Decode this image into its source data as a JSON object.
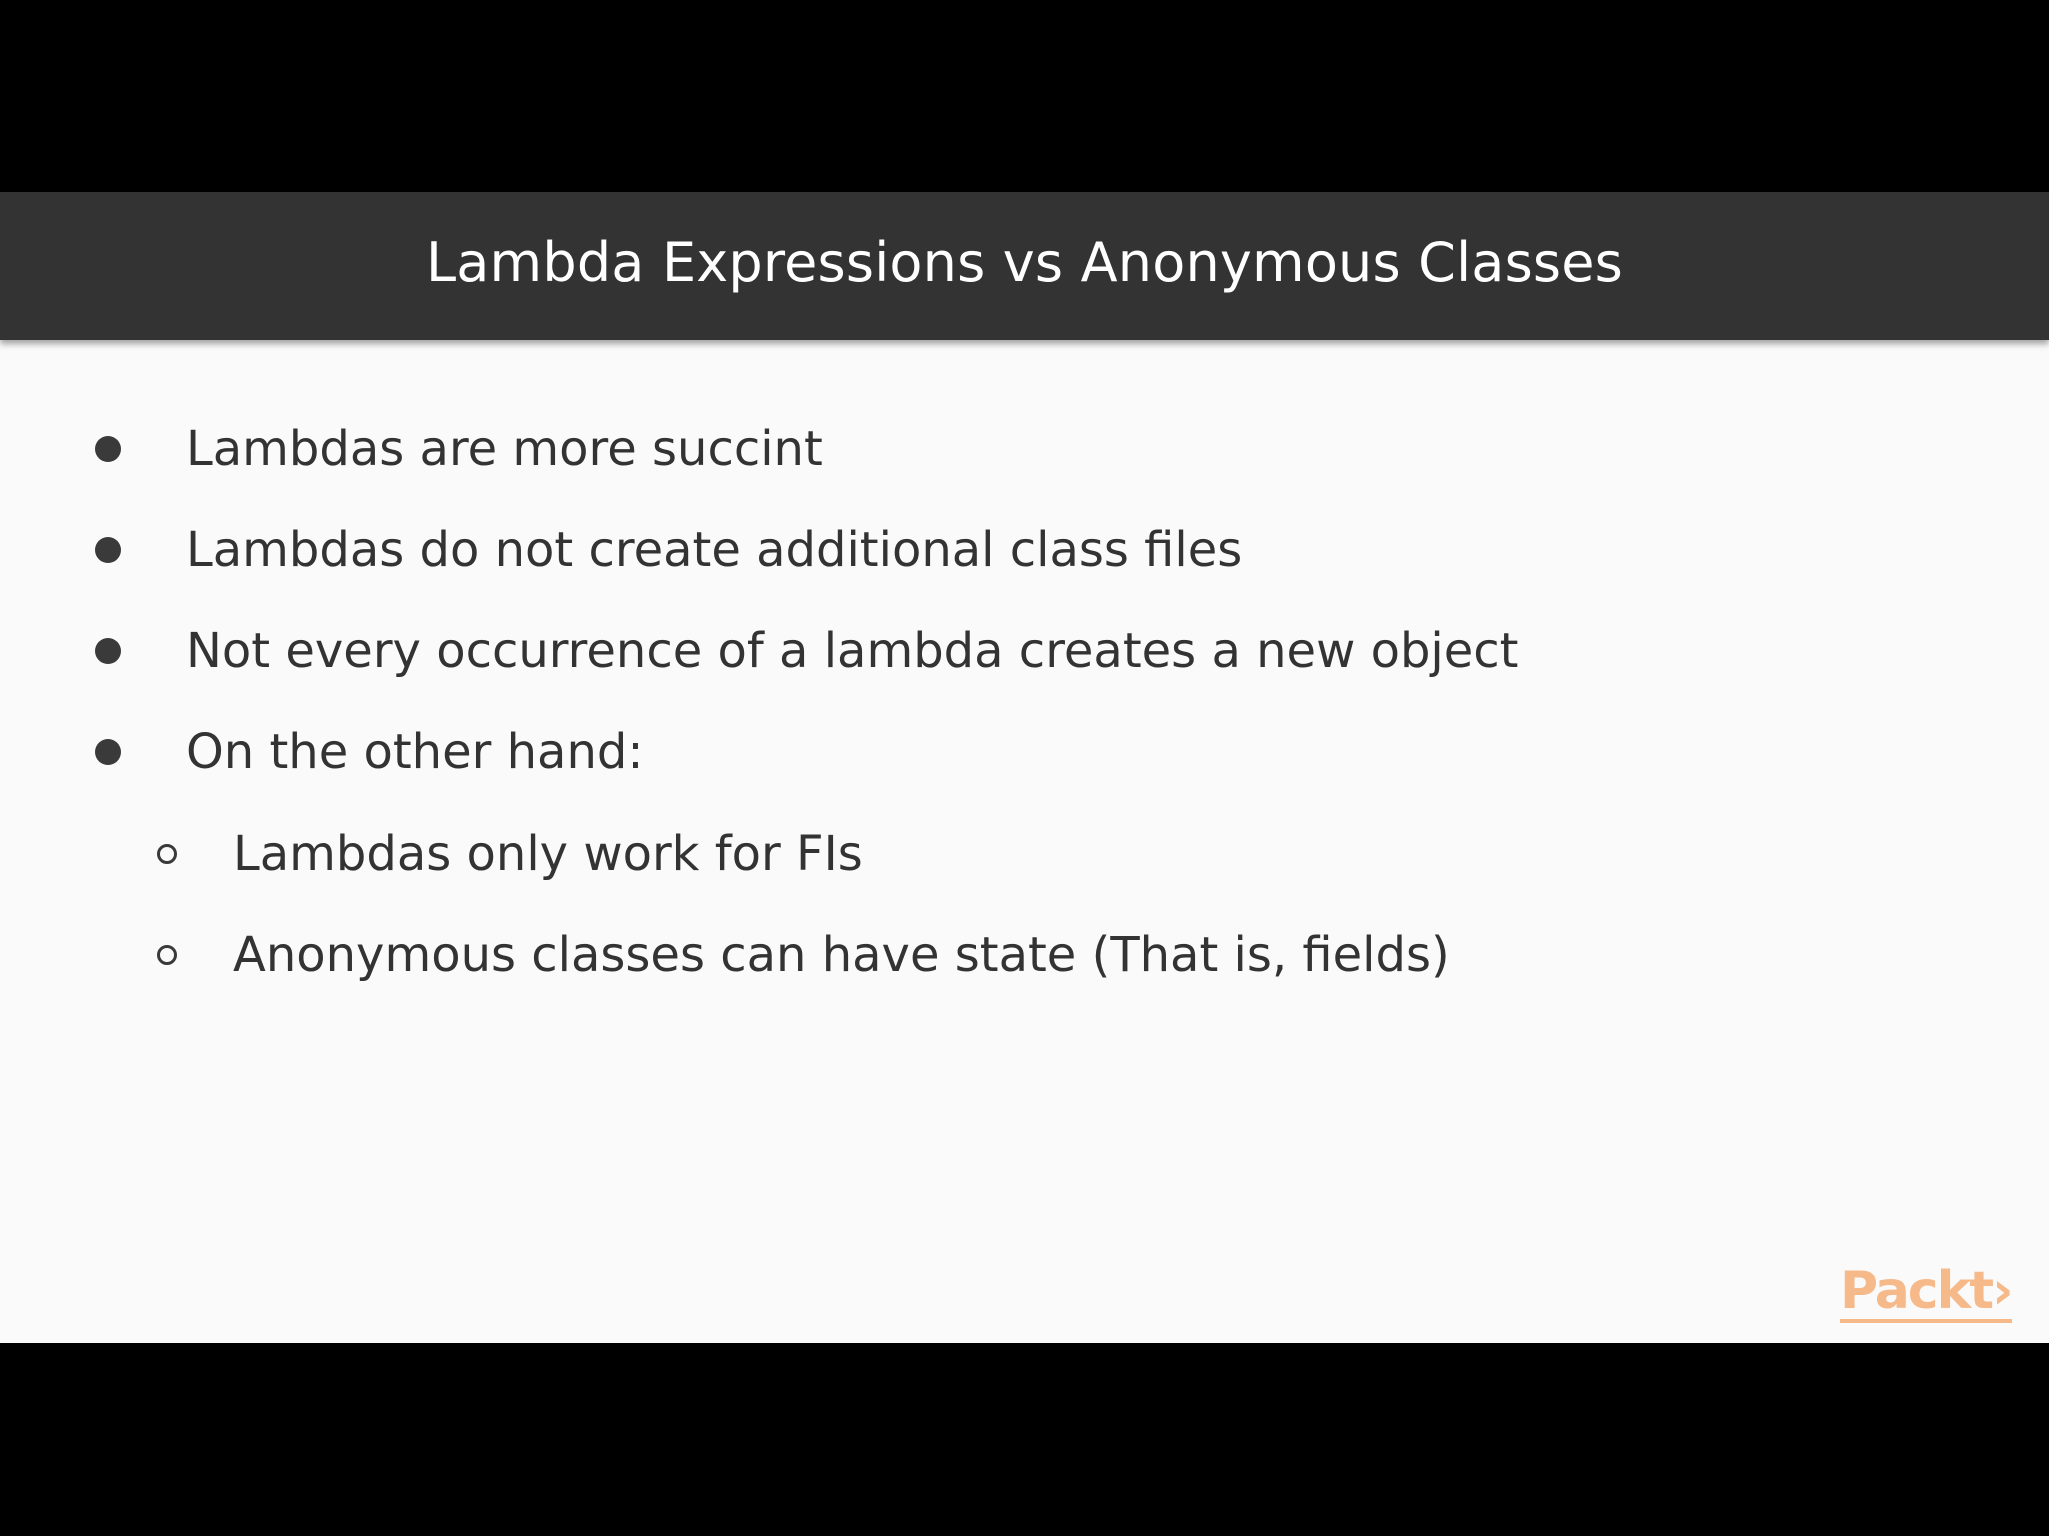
{
  "slide": {
    "title": "Lambda Expressions vs Anonymous Classes",
    "bullets": [
      {
        "text": "Lambdas are more succint",
        "level": 1
      },
      {
        "text": "Lambdas do not create additional class files",
        "level": 1
      },
      {
        "text": "Not every occurrence of a lambda creates a new object",
        "level": 1
      },
      {
        "text": "On the other hand:",
        "level": 1
      },
      {
        "text": "Lambdas only work for FIs",
        "level": 2
      },
      {
        "text": "Anonymous classes can have state (That is, fields)",
        "level": 2
      }
    ],
    "logo_text": "Packt›"
  },
  "colors": {
    "background": "#000000",
    "slide_background": "#fafafa",
    "title_bar": "#333333",
    "title_text": "#ffffff",
    "body_text": "#333333",
    "logo": "#f5b98a"
  }
}
